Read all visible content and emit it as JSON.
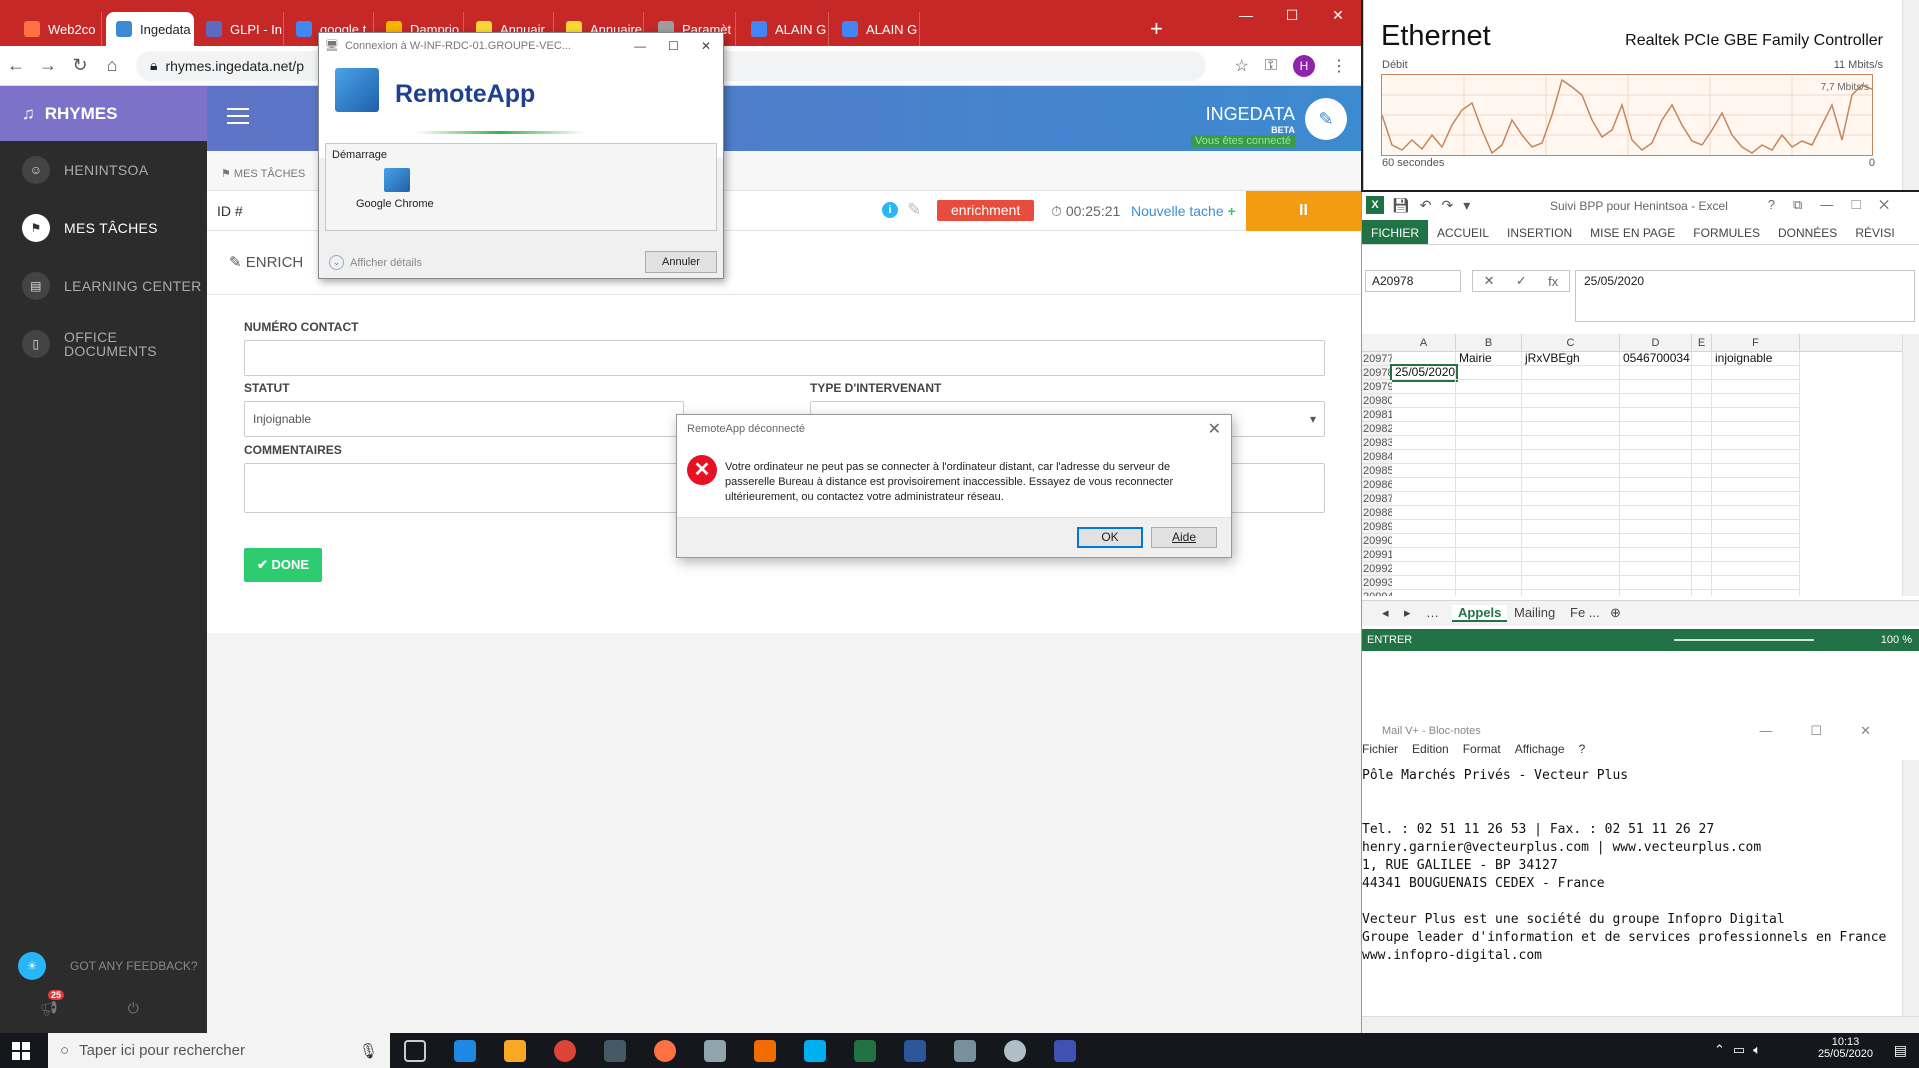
{
  "chrome": {
    "tabs": [
      {
        "label": "Web2co",
        "color": "#ff7043",
        "active": false
      },
      {
        "label": "Ingedata",
        "color": "#3c8ad0",
        "active": true
      },
      {
        "label": "GLPI - In",
        "color": "#5c6bc0",
        "active": false
      },
      {
        "label": "google t",
        "color": "#4285f4",
        "active": false
      },
      {
        "label": "Damprio",
        "color": "#f4b400",
        "active": false
      },
      {
        "label": "Annuair",
        "color": "#fdd835",
        "active": false
      },
      {
        "label": "Annuaire",
        "color": "#fdd835",
        "active": false
      },
      {
        "label": "Paramèt",
        "color": "#9e9e9e",
        "active": false
      },
      {
        "label": "ALAIN G",
        "color": "#4285f4",
        "active": false
      },
      {
        "label": "ALAIN G",
        "color": "#4285f4",
        "active": false
      }
    ],
    "new_tab": "+",
    "url": "rhymes.ingedata.net/p",
    "profile_initial": "H"
  },
  "app": {
    "brand": "RHYMES",
    "sidebar": [
      {
        "label": "HENINTSOA",
        "icon": "user-avatar",
        "active": false
      },
      {
        "label": "MES TÂCHES",
        "icon": "flag-icon",
        "active": true
      },
      {
        "label": "LEARNING CENTER",
        "icon": "book-icon",
        "active": false
      },
      {
        "label": "OFFICE DOCUMENTS",
        "icon": "document-icon",
        "active": false
      }
    ],
    "feedback": "GOT ANY FEEDBACK?",
    "notif_count": "25",
    "ingedata": {
      "name": "INGEDATA",
      "beta": "BETA",
      "status": "Vous êtes connecté"
    },
    "breadcrumb": "MES TÂCHES",
    "id_label": "ID #",
    "task_type": "enrichment",
    "timer": "00:25:21",
    "new_task": "Nouvelle tache",
    "pause": "II",
    "form": {
      "title": "ENRICH",
      "numero_label": "NUMÉRO CONTACT",
      "numero_value": "",
      "statut_label": "STATUT",
      "statut_value": "Injoignable",
      "type_label": "TYPE D'INTERVENANT",
      "comments_label": "COMMENTAIRES",
      "done": "✔ DONE"
    }
  },
  "remoteapp": {
    "title": "Connexion à W-INF-RDC-01.GROUPE-VEC...",
    "name": "RemoteApp",
    "section": "Démarrage",
    "app": "Google Chrome",
    "details": "Afficher détails",
    "cancel": "Annuler"
  },
  "error_dialog": {
    "title": "RemoteApp déconnecté",
    "message": "Votre ordinateur ne peut pas se connecter à l'ordinateur distant, car l'adresse du serveur de passerelle Bureau à distance est provisoirement inaccessible. Essayez de vous reconnecter ultérieurement, ou contactez votre administrateur réseau.",
    "ok": "OK",
    "help": "Aide"
  },
  "ethernet": {
    "title": "Ethernet",
    "controller": "Realtek PCIe GBE Family Controller",
    "debit": "Débit",
    "max": "11 Mbits/s",
    "current": "7,7 Mbits/s",
    "window": "60 secondes",
    "zero": "0",
    "line_color": "#c7865a"
  },
  "excel": {
    "doc_title": "Suivi BPP pour Henintsoa - Excel",
    "ribbon": [
      "FICHIER",
      "ACCUEIL",
      "INSERTION",
      "MISE EN PAGE",
      "FORMULES",
      "DONNÉES",
      "RÉVISI"
    ],
    "namebox": "A20978",
    "formula": "25/05/2020",
    "columns": [
      "A",
      "B",
      "C",
      "D",
      "E",
      "F"
    ],
    "rows": [
      {
        "n": "20977",
        "cells": [
          "",
          "Mairie",
          "jRxVBEgh",
          "0546700034",
          "",
          "injoignable"
        ]
      },
      {
        "n": "20978",
        "cells": [
          "25/05/2020",
          "",
          "",
          "",
          "",
          ""
        ]
      },
      {
        "n": "20979",
        "cells": [
          "",
          "",
          "",
          "",
          "",
          ""
        ]
      },
      {
        "n": "20980",
        "cells": [
          "",
          "",
          "",
          "",
          "",
          ""
        ]
      },
      {
        "n": "20981",
        "cells": [
          "",
          "",
          "",
          "",
          "",
          ""
        ]
      },
      {
        "n": "20982",
        "cells": [
          "",
          "",
          "",
          "",
          "",
          ""
        ]
      },
      {
        "n": "20983",
        "cells": [
          "",
          "",
          "",
          "",
          "",
          ""
        ]
      },
      {
        "n": "20984",
        "cells": [
          "",
          "",
          "",
          "",
          "",
          ""
        ]
      },
      {
        "n": "20985",
        "cells": [
          "",
          "",
          "",
          "",
          "",
          ""
        ]
      },
      {
        "n": "20986",
        "cells": [
          "",
          "",
          "",
          "",
          "",
          ""
        ]
      },
      {
        "n": "20987",
        "cells": [
          "",
          "",
          "",
          "",
          "",
          ""
        ]
      },
      {
        "n": "20988",
        "cells": [
          "",
          "",
          "",
          "",
          "",
          ""
        ]
      },
      {
        "n": "20989",
        "cells": [
          "",
          "",
          "",
          "",
          "",
          ""
        ]
      },
      {
        "n": "20990",
        "cells": [
          "",
          "",
          "",
          "",
          "",
          ""
        ]
      },
      {
        "n": "20991",
        "cells": [
          "",
          "",
          "",
          "",
          "",
          ""
        ]
      },
      {
        "n": "20992",
        "cells": [
          "",
          "",
          "",
          "",
          "",
          ""
        ]
      },
      {
        "n": "20993",
        "cells": [
          "",
          "",
          "",
          "",
          "",
          ""
        ]
      },
      {
        "n": "20994",
        "cells": [
          "",
          "",
          "",
          "",
          "",
          ""
        ]
      }
    ],
    "sheets": [
      "Appels",
      "Mailing",
      "Fe ..."
    ],
    "mode": "ENTRER",
    "zoom": "100 %",
    "accent": "#217346"
  },
  "notepad": {
    "title": "Mail V+ - Bloc-notes",
    "menu": [
      "Fichier",
      "Edition",
      "Format",
      "Affichage",
      "?"
    ],
    "lines": [
      "Pôle Marchés Privés - Vecteur Plus",
      "",
      "",
      "Tel. : 02 51 11 26 53 | Fax. : 02 51 11 26 27",
      "henry.garnier@vecteurplus.com | www.vecteurplus.com",
      "1, RUE GALILEE - BP 34127",
      "44341 BOUGUENAIS CEDEX - France",
      "",
      "Vecteur Plus est une société du groupe Infopro Digital",
      "Groupe leader d'information et de services professionnels en France",
      "www.infopro-digital.com"
    ]
  },
  "taskbar": {
    "search": "Taper ici pour rechercher",
    "time": "10:13",
    "date": "25/05/2020"
  }
}
